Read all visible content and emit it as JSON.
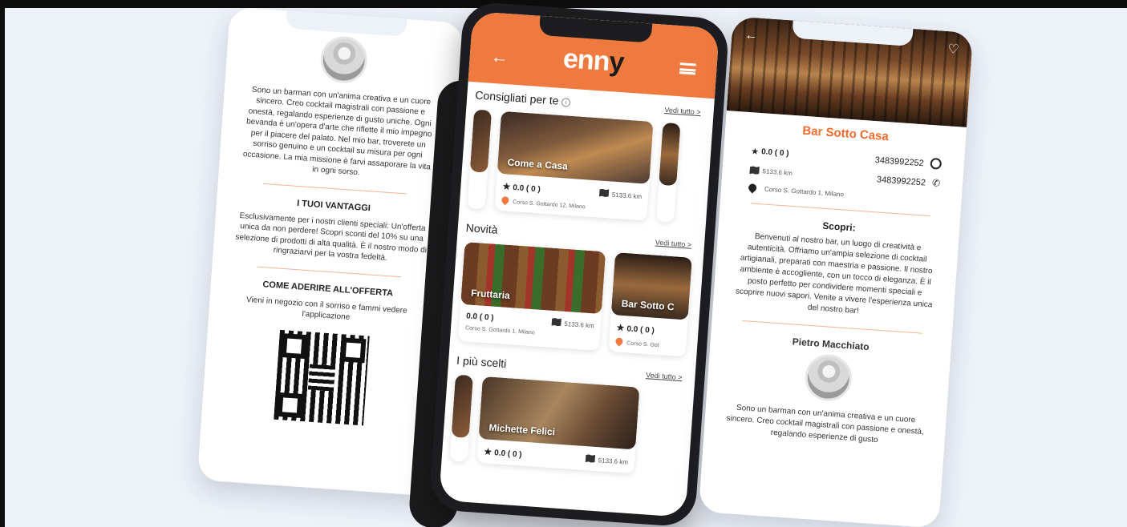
{
  "left_screen": {
    "owner_name": "Pietro Macchiato",
    "bio": "Sono un barman con un'anima creativa e un cuore sincero. Creo cocktail magistrali con passione e onestà, regalando esperienze di gusto uniche. Ogni bevanda è un'opera d'arte che riflette il mio impegno per il piacere del palato. Nel mio bar, troverete un sorriso genuino e un cocktail su misura per ogni occasione. La mia missione è farvi assaporare la vita in ogni sorso.",
    "advantages_title": "I TUOI VANTAGGI",
    "advantages_text": "Esclusivamente per i nostri clienti speciali: Un'offerta unica da non perdere! Scopri sconti del 10% su una selezione di prodotti di alta qualità. È il nostro modo di ringraziarvi per la vostra fedeltà.",
    "join_title": "COME ADERIRE ALL'OFFERTA",
    "join_text": "Vieni in negozio con il sorriso e fammi vedere l'applicazione"
  },
  "middle_phone": {
    "logo_main": "enn",
    "logo_accent": "y",
    "sections": [
      {
        "title": "Consigliati per te",
        "see_all": "Vedi tutto >",
        "cards": [
          {
            "name": "Come a Casa",
            "rating": "0.0 ( 0 )",
            "distance": "5133.6 km",
            "address": "Corso S. Gottardo 12, Milano"
          }
        ]
      },
      {
        "title": "Novità",
        "see_all": "Vedi tutto >",
        "cards": [
          {
            "name": "Fruttaria",
            "rating": "0.0 ( 0 )",
            "distance": "5133.6 km",
            "address": "Corso S. Gottardo 1, Milano"
          },
          {
            "name": "Bar Sotto C",
            "rating": "0.0 ( 0 )",
            "address": "Corso S. Got"
          }
        ]
      },
      {
        "title": "I più scelti",
        "see_all": "Vedi tutto >",
        "cards": [
          {
            "name": "Michette Felici",
            "rating": "0.0 ( 0 )",
            "distance": "5133.6 km"
          }
        ]
      }
    ]
  },
  "right_screen": {
    "title": "Bar Sotto Casa",
    "rating": "0.0 ( 0 )",
    "distance": "5133.6 km",
    "phone_whatsapp": "3483992252",
    "phone_call": "3483992252",
    "address": "Corso S. Gottardo 1, Milano",
    "discover_title": "Scopri:",
    "description": "Benvenuti al nostro bar, un luogo di creatività e autenticità. Offriamo un'ampia selezione di cocktail artigianali, preparati con maestria e passione. Il nostro ambiente è accogliente, con un tocco di eleganza. È il posto perfetto per condividere momenti speciali e scoprire nuovi sapori. Venite a vivere l'esperienza unica del nostro bar!",
    "owner_name": "Pietro Macchiato",
    "owner_bio": "Sono un barman con un'anima creativa e un cuore sincero. Creo cocktail magistrali con passione e onestà, regalando esperienze di gusto"
  },
  "colors": {
    "accent": "#ef7a3f",
    "title_accent": "#ef6b2c",
    "background": "#edf1f8"
  }
}
